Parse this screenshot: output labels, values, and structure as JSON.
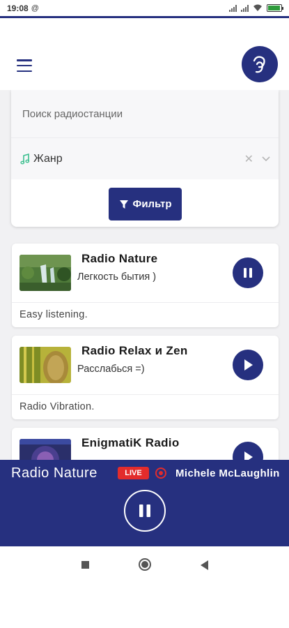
{
  "status_bar": {
    "time": "19:08",
    "at_symbol": "@"
  },
  "search": {
    "placeholder": "Поиск радиостанции",
    "genre_label": "Жанр",
    "clear_symbol": "✕",
    "filter_label": "Фильтр"
  },
  "stations": [
    {
      "name": "Radio Nature",
      "track": "Легкость бытия )",
      "description": "Easy listening.",
      "state": "playing"
    },
    {
      "name": "Radio Relax и Zen",
      "track": "Расслабься =)",
      "description": "Radio Vibration.",
      "state": "paused"
    },
    {
      "name": "EnigmatiK Radio",
      "track": "",
      "description": "",
      "state": "paused"
    }
  ],
  "player": {
    "station_name": "Radio Nature",
    "live_badge": "LIVE",
    "artist": "Michele McLaughlin"
  },
  "colors": {
    "primary": "#26307f",
    "live_red": "#e32c2c",
    "background": "#f1f1f3",
    "genre_icon": "#3bbf8f"
  },
  "icons": {
    "menu": "hamburger-icon",
    "logo": "app-logo",
    "genre": "music-note-icon",
    "filter": "funnel-icon",
    "pause": "pause-icon",
    "play": "play-icon",
    "record": "record-icon"
  }
}
